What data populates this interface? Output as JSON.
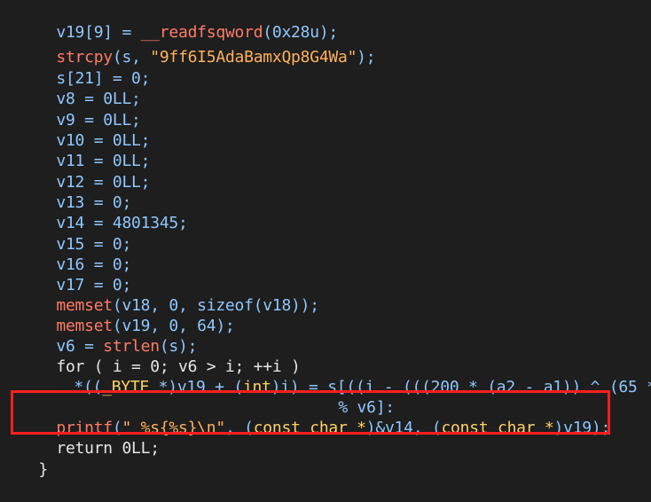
{
  "code": {
    "lines": [
      [
        "v19[9] = ",
        "__readfsqword",
        "(0x28u);"
      ],
      [
        "strcpy",
        "(s, ",
        "\"9ff6I5AdaBamxQp8G4Wa\"",
        ");"
      ],
      [
        "s[21] = 0;"
      ],
      [
        "v8 = 0LL;"
      ],
      [
        "v9 = 0LL;"
      ],
      [
        "v10 = 0LL;"
      ],
      [
        "v11 = 0LL;"
      ],
      [
        "v12 = 0LL;"
      ],
      [
        "v13 = 0;"
      ],
      [
        "v14 = 4801345;"
      ],
      [
        "v15 = 0;"
      ],
      [
        "v16 = 0;"
      ],
      [
        "v17 = 0;"
      ],
      [
        "memset",
        "(v18, 0, sizeof(v18));"
      ],
      [
        "memset",
        "(v19, 0, 64);"
      ],
      [
        "v6 = ",
        "strlen",
        "(s);"
      ],
      [
        "for ( i = 0; v6 > i; ++i )"
      ],
      [
        "*((",
        "_BYTE",
        " *)v19 + (",
        "int",
        ")i) = s[((i - (((200 * (a2 - a1)) ^ (65 *"
      ],
      [
        "% v6]:"
      ],
      [
        "printf",
        "(",
        "\" %s{%s}\\n\"",
        ", (",
        "const char *",
        ")&v14, (",
        "const char *",
        ")v19);"
      ],
      [
        "return 0LL;"
      ],
      [
        "}"
      ]
    ]
  }
}
